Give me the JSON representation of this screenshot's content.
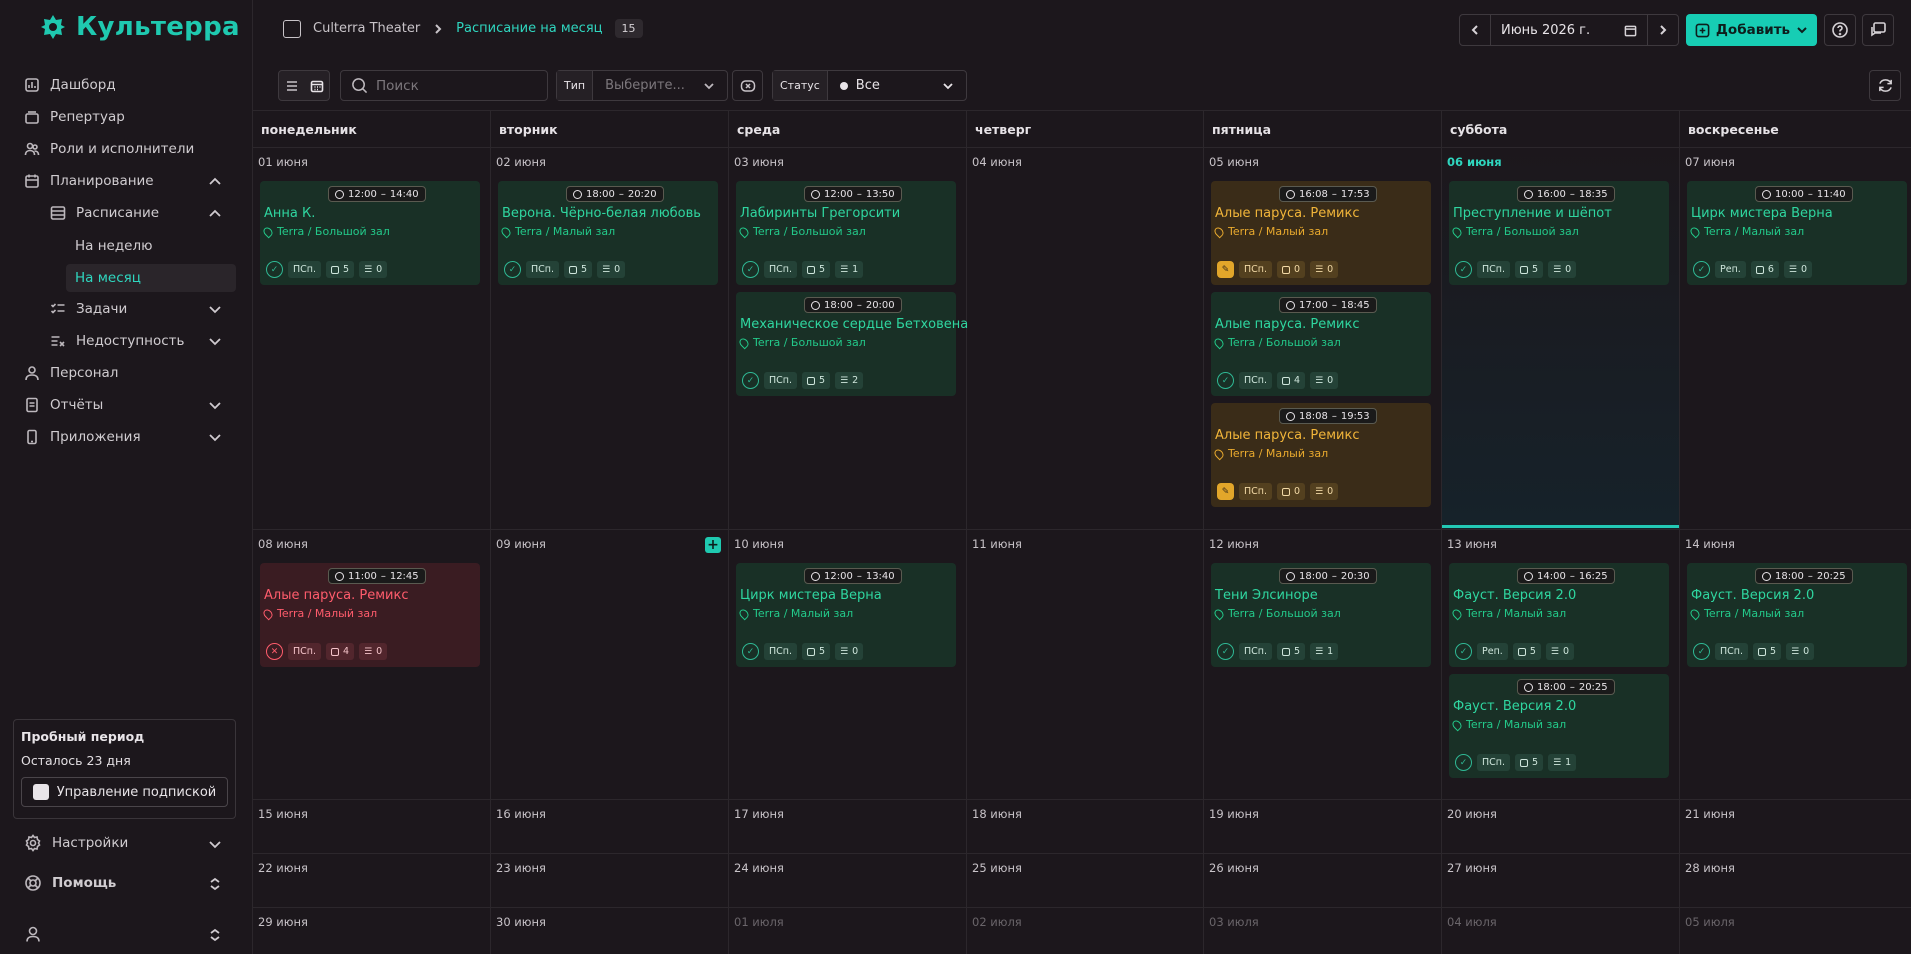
{
  "app": {
    "name": "Культерра",
    "accent": "#1fc9b0"
  },
  "sidebar": {
    "items": [
      {
        "label": "Дашборд"
      },
      {
        "label": "Репертуар"
      },
      {
        "label": "Роли и исполнители"
      },
      {
        "label": "Планирование"
      },
      {
        "label": "Расписание"
      },
      {
        "label": "На неделю"
      },
      {
        "label": "На месяц"
      },
      {
        "label": "Задачи"
      },
      {
        "label": "Недоступность"
      },
      {
        "label": "Персонал"
      },
      {
        "label": "Отчёты"
      },
      {
        "label": "Приложения"
      }
    ],
    "trial": {
      "title": "Пробный период",
      "remaining": "Осталось 23 дня",
      "button": "Управление подпиской"
    },
    "settings": "Настройки",
    "help": "Помощь"
  },
  "header": {
    "breadcrumb": [
      "Culterra Theater",
      "Расписание на месяц"
    ],
    "count": "15",
    "month": "Июнь 2026 г.",
    "add_label": "Добавить"
  },
  "toolbar": {
    "search_placeholder": "Поиск",
    "type_label": "Тип",
    "type_placeholder": "Выберите...",
    "status_label": "Статус",
    "status_value": "Все"
  },
  "calendar": {
    "weekdays": [
      "понедельник",
      "вторник",
      "среда",
      "четверг",
      "пятница",
      "суббота",
      "воскресенье"
    ],
    "weeks": [
      [
        "01 июня",
        "02 июня",
        "03 июня",
        "04 июня",
        "05 июня",
        "06 июня",
        "07 июня"
      ],
      [
        "08 июня",
        "09 июня",
        "10 июня",
        "11 июня",
        "12 июня",
        "13 июня",
        "14 июня"
      ],
      [
        "15 июня",
        "16 июня",
        "17 июня",
        "18 июня",
        "19 июня",
        "20 июня",
        "21 июня"
      ],
      [
        "22 июня",
        "23 июня",
        "24 июня",
        "25 июня",
        "26 июня",
        "27 июня",
        "28 июня"
      ],
      [
        "29 июня",
        "30 июня",
        "01 июля",
        "02 июля",
        "03 июля",
        "04 июля",
        "05 июля"
      ]
    ],
    "events": [
      {
        "week": 0,
        "day": 0,
        "slot": 0,
        "status": "confirmed",
        "time_start": "12:00",
        "time_end": "14:40",
        "title": "Анна К.",
        "place": "Terra / Большой зал",
        "type": "ПСп.",
        "people": "5",
        "tasks": "0"
      },
      {
        "week": 0,
        "day": 1,
        "slot": 0,
        "status": "confirmed",
        "time_start": "18:00",
        "time_end": "20:20",
        "title": "Верона. Чёрно-белая любовь",
        "place": "Terra / Малый зал",
        "type": "ПСп.",
        "people": "5",
        "tasks": "0"
      },
      {
        "week": 0,
        "day": 2,
        "slot": 0,
        "status": "confirmed",
        "time_start": "12:00",
        "time_end": "13:50",
        "title": "Лабиринты Грегорсити",
        "place": "Terra / Большой зал",
        "type": "ПСп.",
        "people": "5",
        "tasks": "1"
      },
      {
        "week": 0,
        "day": 2,
        "slot": 1,
        "status": "confirmed",
        "time_start": "18:00",
        "time_end": "20:00",
        "title": "Механическое сердце Бетховена",
        "place": "Terra / Большой зал",
        "type": "ПСп.",
        "people": "5",
        "tasks": "2"
      },
      {
        "week": 0,
        "day": 4,
        "slot": 0,
        "status": "draft",
        "time_start": "16:08",
        "time_end": "17:53",
        "title": "Алые паруса. Ремикс",
        "place": "Terra / Малый зал",
        "type": "ПСп.",
        "people": "0",
        "tasks": "0"
      },
      {
        "week": 0,
        "day": 4,
        "slot": 1,
        "status": "confirmed",
        "time_start": "17:00",
        "time_end": "18:45",
        "title": "Алые паруса. Ремикс",
        "place": "Terra / Большой зал",
        "type": "ПСп.",
        "people": "4",
        "tasks": "0"
      },
      {
        "week": 0,
        "day": 4,
        "slot": 2,
        "status": "draft",
        "time_start": "18:08",
        "time_end": "19:53",
        "title": "Алые паруса. Ремикс",
        "place": "Terra / Малый зал",
        "type": "ПСп.",
        "people": "0",
        "tasks": "0"
      },
      {
        "week": 0,
        "day": 5,
        "slot": 0,
        "status": "confirmed",
        "time_start": "16:00",
        "time_end": "18:35",
        "title": "Преступление и шёпот",
        "place": "Terra / Большой зал",
        "type": "ПСп.",
        "people": "5",
        "tasks": "0"
      },
      {
        "week": 0,
        "day": 6,
        "slot": 0,
        "status": "confirmed",
        "time_start": "10:00",
        "time_end": "11:40",
        "title": "Цирк мистера Верна",
        "place": "Terra / Малый зал",
        "type": "Реп.",
        "people": "6",
        "tasks": "0"
      },
      {
        "week": 1,
        "day": 0,
        "slot": 0,
        "status": "cancelled",
        "time_start": "11:00",
        "time_end": "12:45",
        "title": "Алые паруса. Ремикс",
        "place": "Terra / Малый зал",
        "type": "ПСп.",
        "people": "4",
        "tasks": "0"
      },
      {
        "week": 1,
        "day": 2,
        "slot": 0,
        "status": "confirmed",
        "time_start": "12:00",
        "time_end": "13:40",
        "title": "Цирк мистера Верна",
        "place": "Terra / Малый зал",
        "type": "ПСп.",
        "people": "5",
        "tasks": "0"
      },
      {
        "week": 1,
        "day": 4,
        "slot": 0,
        "status": "confirmed",
        "time_start": "18:00",
        "time_end": "20:30",
        "title": "Тени Элсиноре",
        "place": "Terra / Большой зал",
        "type": "ПСп.",
        "people": "5",
        "tasks": "1"
      },
      {
        "week": 1,
        "day": 5,
        "slot": 0,
        "status": "confirmed",
        "time_start": "14:00",
        "time_end": "16:25",
        "title": "Фауст. Версия 2.0",
        "place": "Terra / Малый зал",
        "type": "Реп.",
        "people": "5",
        "tasks": "0"
      },
      {
        "week": 1,
        "day": 5,
        "slot": 1,
        "status": "confirmed",
        "time_start": "18:00",
        "time_end": "20:25",
        "title": "Фауст. Версия 2.0",
        "place": "Terra / Малый зал",
        "type": "ПСп.",
        "people": "5",
        "tasks": "1"
      },
      {
        "week": 1,
        "day": 6,
        "slot": 0,
        "status": "confirmed",
        "time_start": "18:00",
        "time_end": "20:25",
        "title": "Фауст. Версия 2.0",
        "place": "Terra / Малый зал",
        "type": "ПСп.",
        "people": "5",
        "tasks": "0"
      }
    ]
  }
}
